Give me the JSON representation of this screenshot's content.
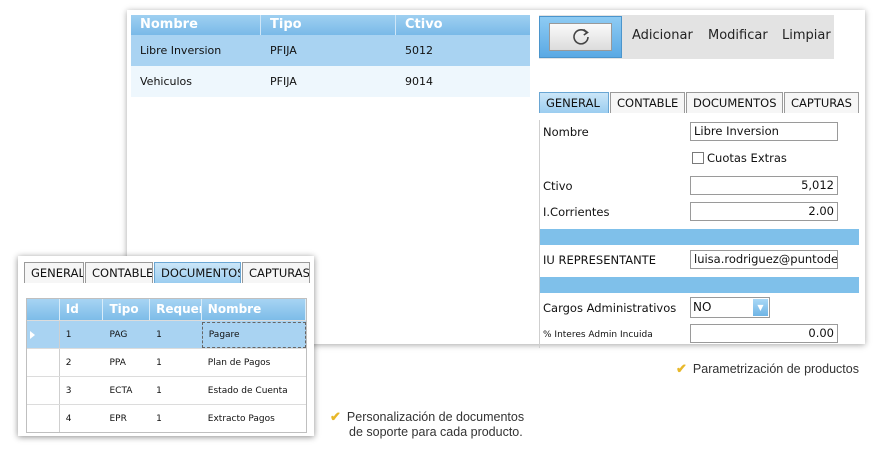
{
  "products_grid": {
    "columns": [
      "Nombre",
      "Tipo",
      "Ctivo"
    ],
    "rows": [
      {
        "nombre": "Libre Inversion",
        "tipo": "PFIJA",
        "ctivo": "5012"
      },
      {
        "nombre": "Vehiculos",
        "tipo": "PFIJA",
        "ctivo": "9014"
      }
    ]
  },
  "toolbar": {
    "refresh_icon": "refresh-icon",
    "add_label": "Adicionar",
    "modify_label": "Modificar",
    "clear_label": "Limpiar"
  },
  "main_tabs": [
    "GENERAL",
    "CONTABLE",
    "DOCUMENTOS",
    "CAPTURAS"
  ],
  "general_form": {
    "nombre_label": "Nombre",
    "nombre_value": "Libre Inversion",
    "cuotas_label": "Cuotas Extras",
    "ctivo_label": "Ctivo",
    "ctivo_value": "5,012",
    "icorrientes_label": "I.Corrientes",
    "icorrientes_value": "2.00",
    "iu_label": "IU REPRESENTANTE",
    "iu_value": "luisa.rodriguez@puntodepa",
    "cargos_label": "Cargos Administrativos",
    "cargos_value": "NO",
    "interes_label": "% Interes Admin Incuida",
    "interes_value": "0.00"
  },
  "doc_tabs": [
    "GENERAL",
    "CONTABLE",
    "DOCUMENTOS",
    "CAPTURAS"
  ],
  "documents_grid": {
    "columns": [
      "Id",
      "Tipo",
      "Requer",
      "Nombre"
    ],
    "rows": [
      {
        "id": "1",
        "tipo": "PAG",
        "req": "1",
        "nombre": "Pagare"
      },
      {
        "id": "2",
        "tipo": "PPA",
        "req": "1",
        "nombre": "Plan de Pagos"
      },
      {
        "id": "3",
        "tipo": "ECTA",
        "req": "1",
        "nombre": "Estado de Cuenta"
      },
      {
        "id": "4",
        "tipo": "EPR",
        "req": "1",
        "nombre": "Extracto Pagos"
      }
    ]
  },
  "captions": {
    "products": "Parametrización de productos",
    "documents_line1": "Personalización de documentos",
    "documents_line2": "de soporte para cada producto."
  },
  "colors": {
    "accent": "#7fc0ea",
    "selected_row": "#a9d3f2",
    "check_mark": "#e8b82a"
  }
}
